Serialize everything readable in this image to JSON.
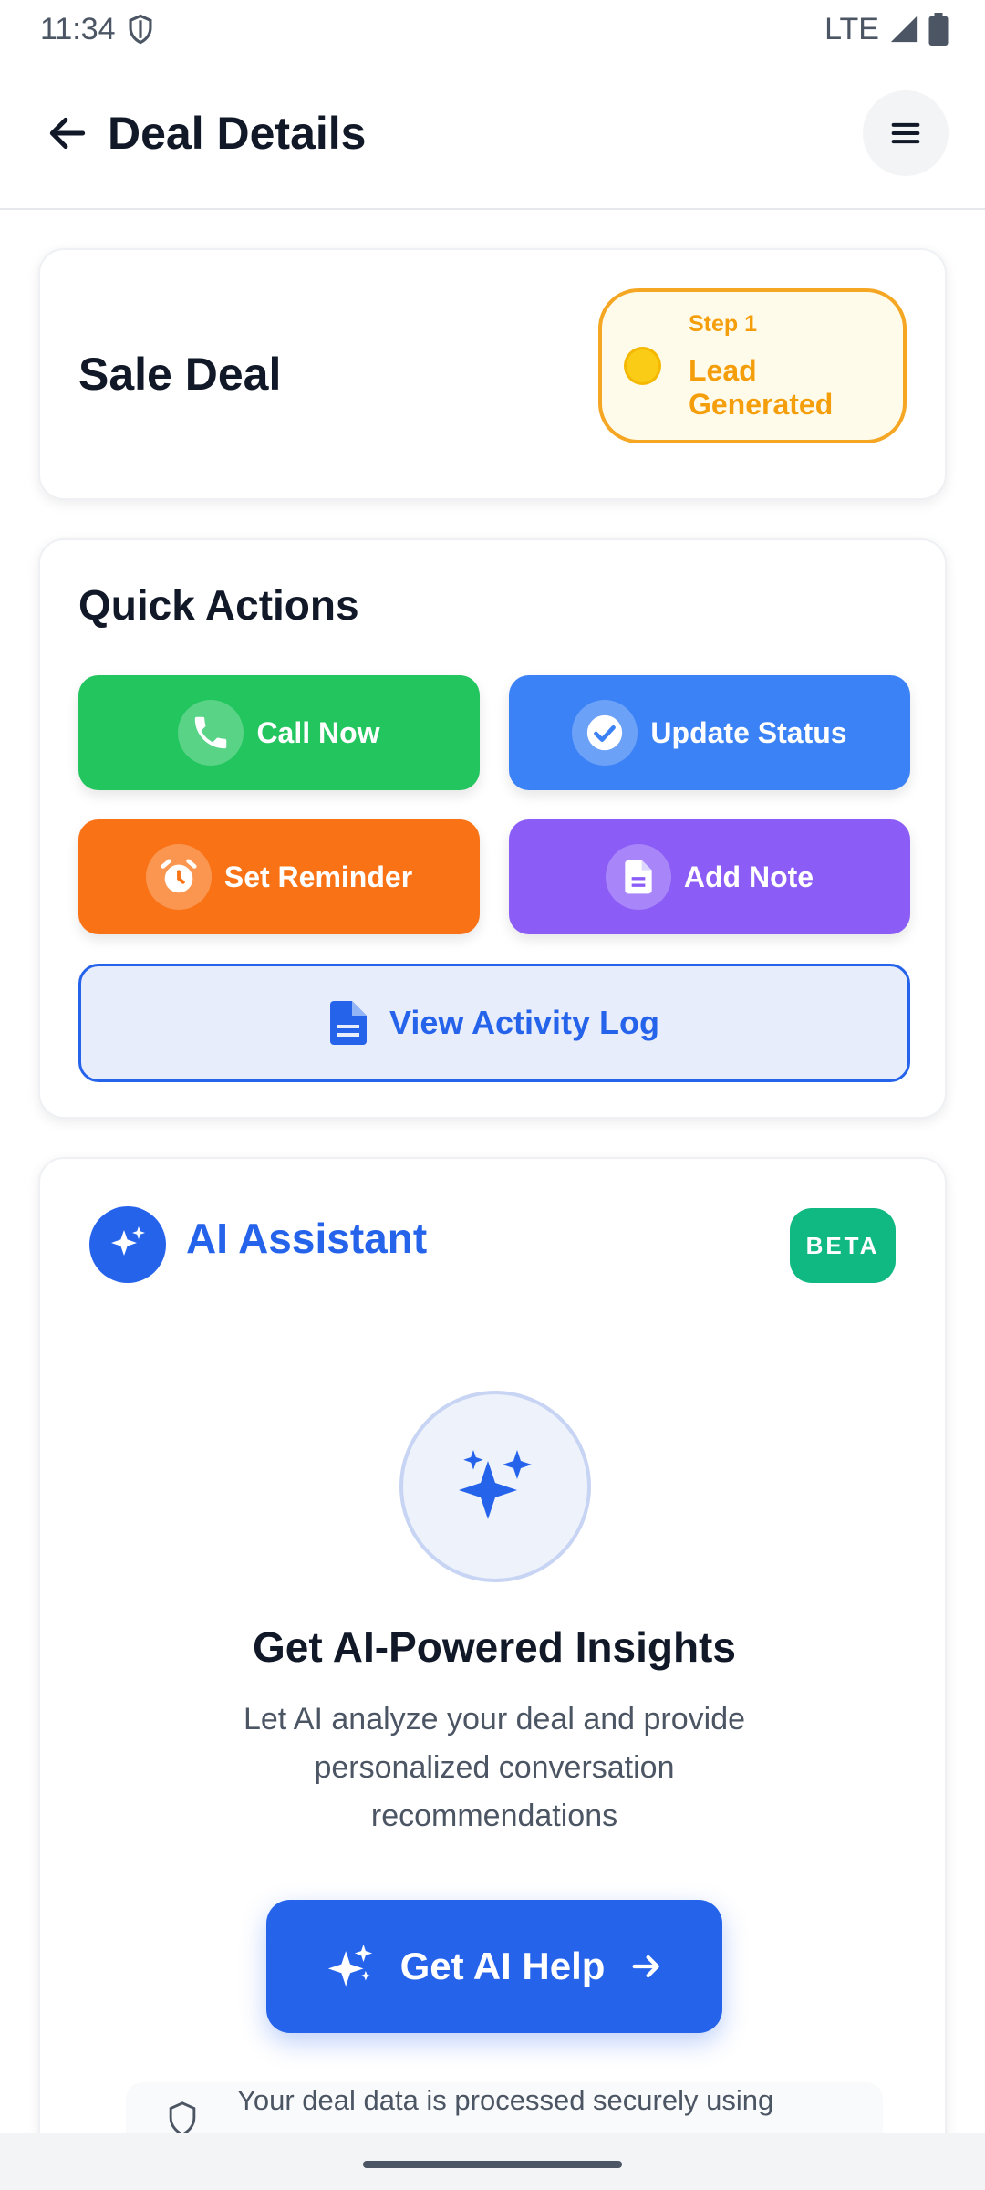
{
  "status_bar": {
    "time": "11:34",
    "network": "LTE"
  },
  "app_bar": {
    "title": "Deal Details"
  },
  "deal": {
    "title": "Sale Deal",
    "step_number": "Step 1",
    "step_label": "Lead Generated"
  },
  "quick_actions": {
    "title": "Quick Actions",
    "call": "Call Now",
    "update_status": "Update Status",
    "set_reminder": "Set Reminder",
    "add_note": "Add Note",
    "view_activity": "View Activity Log"
  },
  "ai": {
    "title": "AI Assistant",
    "badge": "BETA",
    "heading": "Get AI-Powered Insights",
    "description": "Let AI analyze your deal and provide personalized conversation recommendations",
    "button": "Get AI Help",
    "secure_note": "Your deal data is processed securely using"
  },
  "colors": {
    "primary": "#2563eb",
    "call": "#22c55e",
    "status": "#3b82f6",
    "reminder": "#f97316",
    "note": "#8b5cf6",
    "step": "#f59e0b",
    "beta": "#10b981"
  },
  "icons": {
    "back": "arrow-left-icon",
    "menu": "hamburger-menu-icon",
    "call": "phone-icon",
    "status": "check-circle-icon",
    "reminder": "alarm-clock-icon",
    "note": "document-icon",
    "activity": "document-icon",
    "ai": "sparkles-icon",
    "help_arrow": "arrow-right-icon",
    "secure": "shield-icon"
  }
}
